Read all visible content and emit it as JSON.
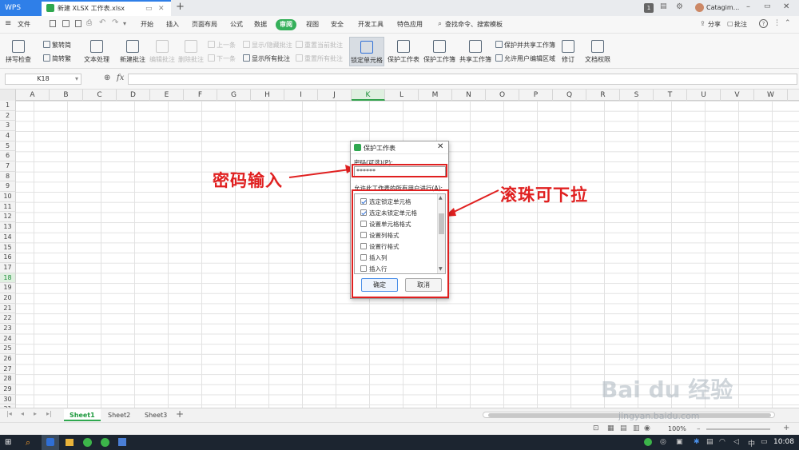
{
  "titlebar": {
    "app_tab": "WPS",
    "doc_tab": "新建 XLSX 工作表.xlsx",
    "add_tab": "+",
    "user": "Catagim...",
    "badge": "1"
  },
  "menubar": {
    "file": "文件",
    "items": [
      "开始",
      "插入",
      "页面布局",
      "公式",
      "数据",
      "审阅",
      "视图",
      "安全",
      "开发工具",
      "特色应用"
    ],
    "active": "审阅",
    "search": "查找命令、搜索模板",
    "share": "分享",
    "comment": "批注"
  },
  "ribbon": {
    "spell_check": "拼写检查",
    "trad_to_simp": "繁转简",
    "simp_to_trad": "简转繁",
    "text_process": "文本处理",
    "new_comment": "新建批注",
    "edit_comment": "编辑批注",
    "delete_comment": "删除批注",
    "prev": "上一条",
    "next": "下一条",
    "show_hide_comment": "显示/隐藏批注",
    "show_all_comments": "显示所有批注",
    "reset_current_comment": "重置当前批注",
    "reset_all_comments": "重置所有批注",
    "lock_cell": "锁定单元格",
    "protect_sheet": "保护工作表",
    "protect_workbook": "保护工作簿",
    "share_workbook": "共享工作簿",
    "protect_shared": "保护并共享工作簿",
    "allow_edit_ranges": "允许用户编辑区域",
    "revisions": "修订",
    "doc_rights": "文档权限"
  },
  "formulabar": {
    "cell_ref": "K18",
    "fx": "fx",
    "value": ""
  },
  "grid": {
    "columns": [
      "A",
      "B",
      "C",
      "D",
      "E",
      "F",
      "G",
      "H",
      "I",
      "J",
      "K",
      "L",
      "M",
      "N",
      "O",
      "P",
      "Q",
      "R",
      "S",
      "T",
      "U",
      "V",
      "W"
    ],
    "rows": [
      "1",
      "2",
      "3",
      "4",
      "5",
      "6",
      "7",
      "8",
      "9",
      "10",
      "11",
      "12",
      "13",
      "14",
      "15",
      "16",
      "17",
      "18",
      "19",
      "20",
      "21",
      "22",
      "23",
      "24",
      "25",
      "26",
      "27",
      "28",
      "29",
      "30",
      "31"
    ],
    "selected_col": "K",
    "selected_row": "18"
  },
  "sheets": {
    "tabs": [
      "Sheet1",
      "Sheet2",
      "Sheet3"
    ],
    "active": "Sheet1",
    "add": "+"
  },
  "statusbar": {
    "zoom": "100%"
  },
  "taskbar": {
    "time": "10:08"
  },
  "dialog": {
    "title": "保护工作表",
    "password_label": "密码(可选)(P):",
    "password_value": "******",
    "allow_label": "允许此工作表的所有用户进行(A):",
    "options": [
      {
        "label": "选定锁定单元格",
        "checked": true
      },
      {
        "label": "选定未锁定单元格",
        "checked": true
      },
      {
        "label": "设置单元格格式",
        "checked": false
      },
      {
        "label": "设置列格式",
        "checked": false
      },
      {
        "label": "设置行格式",
        "checked": false
      },
      {
        "label": "插入列",
        "checked": false
      },
      {
        "label": "插入行",
        "checked": false
      }
    ],
    "ok": "确定",
    "cancel": "取消"
  },
  "annotations": {
    "password_note": "密码输入",
    "scroll_note": "滚珠可下拉"
  },
  "watermark": {
    "text": "Bai du 经验",
    "url": "jingyan.baidu.com"
  }
}
